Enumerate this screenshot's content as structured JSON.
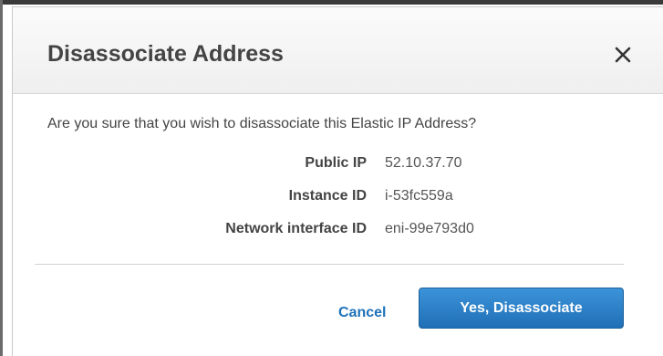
{
  "dialog": {
    "title": "Disassociate Address",
    "close_icon": "close-icon",
    "message": "Are you sure that you wish to disassociate this Elastic IP Address?",
    "details": [
      {
        "label": "Public IP",
        "value": "52.10.37.70"
      },
      {
        "label": "Instance ID",
        "value": "i-53fc559a"
      },
      {
        "label": "Network interface ID",
        "value": "eni-99e793d0"
      }
    ],
    "cancel_label": "Cancel",
    "confirm_label": "Yes, Disassociate"
  },
  "colors": {
    "primary_button": "#2a7fc7",
    "link": "#1e72b8",
    "title_text": "#444444"
  }
}
